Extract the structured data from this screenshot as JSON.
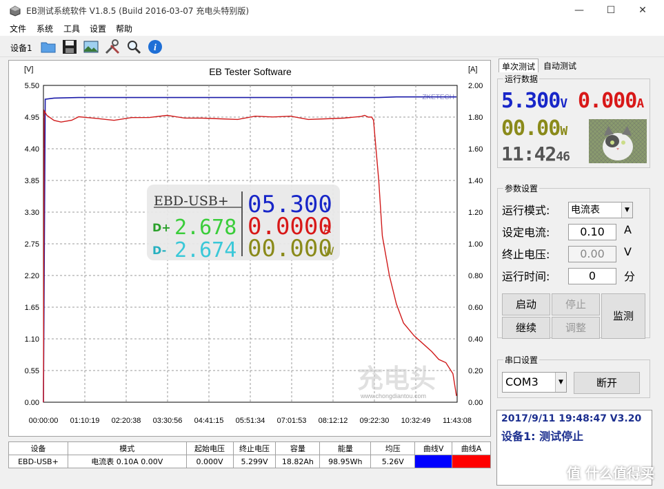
{
  "window": {
    "title": "EB测试系统软件 V1.8.5 (Build 2016-03-07 充电头特别版)",
    "minimize": "—",
    "maximize": "☐",
    "close": "✕"
  },
  "menu": [
    "文件",
    "系统",
    "工具",
    "设置",
    "帮助"
  ],
  "toolbar": {
    "device_label": "设备1",
    "icons": [
      "folder-icon",
      "save-icon",
      "image-icon",
      "tools-icon",
      "search-icon",
      "info-icon"
    ]
  },
  "chart_data": {
    "type": "line",
    "title": "EB Tester Software",
    "y_left_unit": "[V]",
    "y_right_unit": "[A]",
    "y_left_ticks": [
      "5.50",
      "4.95",
      "4.40",
      "3.85",
      "3.30",
      "2.75",
      "2.20",
      "1.65",
      "1.10",
      "0.55",
      "0.00"
    ],
    "y_right_ticks": [
      "2.00",
      "1.80",
      "1.60",
      "1.40",
      "1.20",
      "1.00",
      "0.80",
      "0.60",
      "0.40",
      "0.20",
      "0.00"
    ],
    "x_ticks": [
      "00:00:00",
      "01:10:19",
      "02:20:38",
      "03:30:56",
      "04:41:15",
      "05:51:34",
      "07:01:53",
      "08:12:12",
      "09:22:30",
      "10:32:49",
      "11:43:08"
    ],
    "ylim_left": [
      0,
      5.5
    ],
    "ylim_right": [
      0,
      2.0
    ],
    "grid": true,
    "brand_label": "ZKETECH",
    "series": [
      {
        "axis": "left",
        "color": "#1a1aa8",
        "x": [
          0,
          0.05,
          0.3,
          1,
          2,
          4,
          6,
          8,
          9,
          9.3,
          9.5,
          10,
          10.5,
          11,
          11.7
        ],
        "values": [
          0,
          5.26,
          5.28,
          5.29,
          5.29,
          5.29,
          5.29,
          5.29,
          5.29,
          5.29,
          5.29,
          5.3,
          5.3,
          5.3,
          5.3
        ]
      },
      {
        "axis": "right",
        "color": "#d01a1a",
        "x": [
          0,
          0.02,
          0.1,
          0.3,
          0.5,
          0.8,
          1.0,
          1.5,
          2,
          2.5,
          3,
          3.5,
          4,
          4.5,
          5,
          5.5,
          6,
          6.5,
          7,
          7.5,
          8,
          8.5,
          9,
          9.1,
          9.2,
          9.3,
          9.35,
          9.5,
          9.6,
          9.8,
          10,
          10.2,
          10.5,
          10.8,
          11.0,
          11.2,
          11.4,
          11.6,
          11.7
        ],
        "values": [
          0,
          1.84,
          1.82,
          1.78,
          1.76,
          1.77,
          1.8,
          1.8,
          1.79,
          1.8,
          1.79,
          1.8,
          1.79,
          1.8,
          1.8,
          1.79,
          1.8,
          1.79,
          1.8,
          1.79,
          1.8,
          1.8,
          1.8,
          1.8,
          1.8,
          1.8,
          1.78,
          1.4,
          1.05,
          0.8,
          0.62,
          0.5,
          0.42,
          0.36,
          0.32,
          0.27,
          0.25,
          0.18,
          0.04
        ]
      }
    ]
  },
  "overlay": {
    "model": "EBD-USB+",
    "dp_label": "D+",
    "dp_value": "2.678",
    "dm_label": "D-",
    "dm_value": "2.674",
    "voltage": "05.300",
    "voltage_unit": "V",
    "current": "0.0000",
    "current_unit": "A",
    "power": "00.000",
    "power_unit": "W"
  },
  "watermark": {
    "logo": "充电头",
    "url": "www.chongdiantou.com"
  },
  "table": {
    "headers": [
      "设备",
      "模式",
      "起始电压",
      "终止电压",
      "容量",
      "能量",
      "均压",
      "曲线V",
      "曲线A"
    ],
    "row": [
      "EBD-USB+",
      "电流表  0.10A  0.00V",
      "0.000V",
      "5.299V",
      "18.82Ah",
      "98.95Wh",
      "5.26V",
      "",
      ""
    ],
    "curve_v_color": "#0000ff",
    "curve_a_color": "#ff0000"
  },
  "tabs": [
    "单次测试",
    "自动测试"
  ],
  "run_data": {
    "title": "运行数据",
    "voltage": "5.300",
    "voltage_unit": "V",
    "current": "0.000",
    "current_unit": "A",
    "power": "00.00",
    "power_unit": "W",
    "time": "11:42",
    "seconds": "46"
  },
  "params": {
    "title": "参数设置",
    "mode_label": "运行模式:",
    "mode_value": "电流表",
    "current_label": "设定电流:",
    "current_value": "0.10",
    "current_unit": "A",
    "end_voltage_label": "终止电压:",
    "end_voltage_value": "0.00",
    "end_voltage_unit": "V",
    "run_time_label": "运行时间:",
    "run_time_value": "0",
    "run_time_unit": "分",
    "start": "启动",
    "stop": "停止",
    "continue": "继续",
    "adjust": "调整",
    "monitor": "监测"
  },
  "serial": {
    "title": "串口设置",
    "port": "COM3",
    "disconnect": "断开"
  },
  "status": {
    "line1": "2017/9/11 19:48:47  V3.20",
    "line2": "设备1: 测试停止"
  },
  "corner_watermark": "值 什么值得买"
}
